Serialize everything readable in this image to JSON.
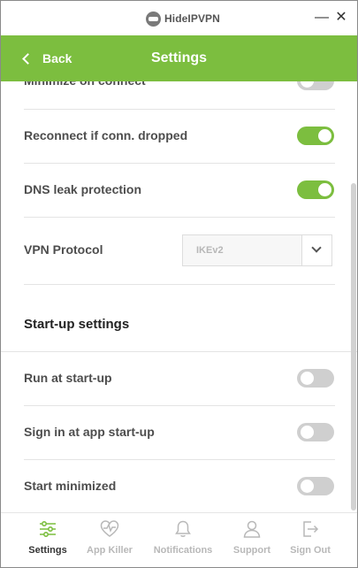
{
  "app": {
    "logo_text": "HideIPVPN"
  },
  "window_controls": {
    "minimize": "—",
    "close": "✕"
  },
  "header": {
    "back_label": "Back",
    "title": "Settings"
  },
  "settings": {
    "minimize_on_connect": {
      "label": "Minimize on connect",
      "enabled": false
    },
    "reconnect": {
      "label": "Reconnect if conn. dropped",
      "enabled": true
    },
    "dns_leak": {
      "label": "DNS leak protection",
      "enabled": true
    },
    "vpn_protocol": {
      "label": "VPN Protocol",
      "value": "IKEv2"
    }
  },
  "startup": {
    "title": "Start-up settings",
    "run_at_startup": {
      "label": "Run at start-up",
      "enabled": false
    },
    "sign_in_at_startup": {
      "label": "Sign in at app start-up",
      "enabled": false
    },
    "start_minimized": {
      "label": "Start minimized",
      "enabled": false
    }
  },
  "nav": [
    {
      "label": "Settings",
      "icon": "sliders-icon",
      "active": true
    },
    {
      "label": "App Killer",
      "icon": "heart-pulse-icon",
      "active": false
    },
    {
      "label": "Notifications",
      "icon": "bell-icon",
      "active": false
    },
    {
      "label": "Support",
      "icon": "user-icon",
      "active": false
    },
    {
      "label": "Sign Out",
      "icon": "sign-out-icon",
      "active": false
    }
  ],
  "colors": {
    "accent": "#7cbe3f",
    "toggle_off": "#cfcfcf",
    "nav_inactive": "#b8b8b8"
  }
}
